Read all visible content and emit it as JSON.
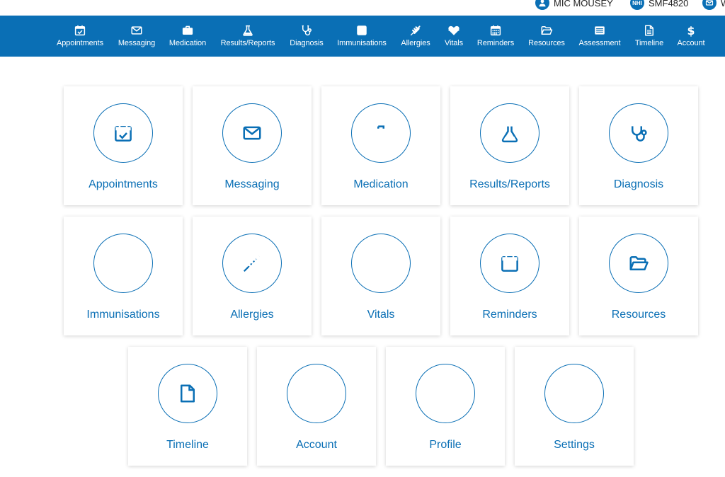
{
  "colors": {
    "brand": "#0a6fb5",
    "background": "#ffffff"
  },
  "user_strip": {
    "user_name": "MIC MOUSEY",
    "nhi_badge": "NHI",
    "nhi_number": "SMF4820",
    "messages_partial": "W"
  },
  "nav": {
    "items": [
      {
        "label": "Appointments",
        "icon": "calendar-check-icon"
      },
      {
        "label": "Messaging",
        "icon": "envelope-icon"
      },
      {
        "label": "Medication",
        "icon": "medkit-icon"
      },
      {
        "label": "Results/Reports",
        "icon": "flask-icon"
      },
      {
        "label": "Diagnosis",
        "icon": "stethoscope-icon"
      },
      {
        "label": "Immunisations",
        "icon": "plus-square-icon"
      },
      {
        "label": "Allergies",
        "icon": "wheat-icon"
      },
      {
        "label": "Vitals",
        "icon": "heartbeat-icon"
      },
      {
        "label": "Reminders",
        "icon": "calendar-grid-icon"
      },
      {
        "label": "Resources",
        "icon": "folder-open-icon"
      },
      {
        "label": "Assessment",
        "icon": "list-card-icon"
      },
      {
        "label": "Timeline",
        "icon": "document-icon"
      },
      {
        "label": "Account",
        "icon": "dollar-icon"
      }
    ]
  },
  "tiles": [
    {
      "label": "Appointments",
      "icon": "calendar-check-icon"
    },
    {
      "label": "Messaging",
      "icon": "envelope-icon"
    },
    {
      "label": "Medication",
      "icon": "medkit-icon"
    },
    {
      "label": "Results/Reports",
      "icon": "flask-icon"
    },
    {
      "label": "Diagnosis",
      "icon": "stethoscope-icon"
    },
    {
      "label": "Immunisations",
      "icon": "plus-square-icon"
    },
    {
      "label": "Allergies",
      "icon": "wheat-icon"
    },
    {
      "label": "Vitals",
      "icon": "heartbeat-icon"
    },
    {
      "label": "Reminders",
      "icon": "calendar-grid-icon"
    },
    {
      "label": "Resources",
      "icon": "folder-open-icon"
    },
    {
      "label": "Timeline",
      "icon": "document-icon"
    },
    {
      "label": "Account",
      "icon": "dollar-icon"
    },
    {
      "label": "Profile",
      "icon": "user-icon"
    },
    {
      "label": "Settings",
      "icon": "gear-icon"
    }
  ]
}
